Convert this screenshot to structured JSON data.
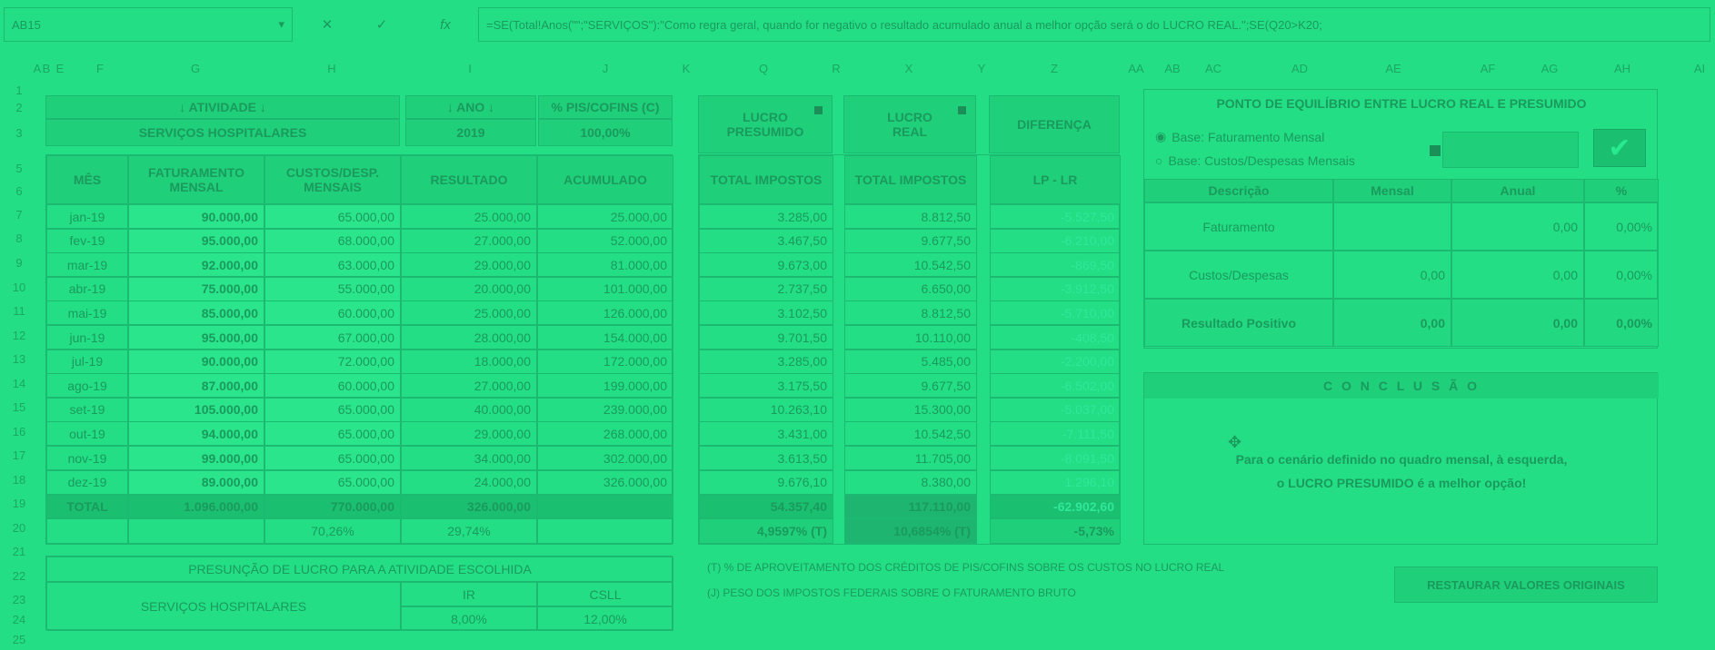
{
  "formula_bar": {
    "name_box": "AB15",
    "formula": "=SE(Total!Anos(\"\";\"SERVIÇOS\"):\"Como regra geral, quando for negativo o resultado acumulado anual a melhor opção será o do LUCRO REAL.\";SE(Q20>K20;",
    "cancel_symbol": "✕",
    "enter_symbol": "✓",
    "fx_symbol": "fx"
  },
  "columns": [
    "A",
    "B",
    "E",
    "F",
    "G",
    "H",
    "I",
    "J",
    "K",
    "Q",
    "R",
    "X",
    "Y",
    "Z",
    "AA",
    "AB",
    "AC",
    "AD",
    "AE",
    "AF",
    "AG",
    "AH",
    "AI"
  ],
  "rows": [
    "1",
    "2",
    "3",
    "5",
    "6",
    "7",
    "8",
    "9",
    "10",
    "11",
    "12",
    "13",
    "14",
    "15",
    "16",
    "17",
    "18",
    "19",
    "20",
    "21",
    "22",
    "23",
    "24",
    "25"
  ],
  "main_table": {
    "atividade_label": "↓ ATIVIDADE ↓",
    "atividade_value": "SERVIÇOS HOSPITALARES",
    "ano_label": "↓ ANO ↓",
    "ano_value": "2019",
    "pis_label": "% PIS/COFINS (C)",
    "pis_value": "100,00%",
    "headers": [
      "MÊS",
      "FATURAMENTO MENSAL",
      "CUSTOS/DESP. MENSAIS",
      "RESULTADO",
      "ACUMULADO"
    ],
    "rows": [
      [
        "jan-19",
        "90.000,00",
        "65.000,00",
        "25.000,00",
        "25.000,00"
      ],
      [
        "fev-19",
        "95.000,00",
        "68.000,00",
        "27.000,00",
        "52.000,00"
      ],
      [
        "mar-19",
        "92.000,00",
        "63.000,00",
        "29.000,00",
        "81.000,00"
      ],
      [
        "abr-19",
        "75.000,00",
        "55.000,00",
        "20.000,00",
        "101.000,00"
      ],
      [
        "mai-19",
        "85.000,00",
        "60.000,00",
        "25.000,00",
        "126.000,00"
      ],
      [
        "jun-19",
        "95.000,00",
        "67.000,00",
        "28.000,00",
        "154.000,00"
      ],
      [
        "jul-19",
        "90.000,00",
        "72.000,00",
        "18.000,00",
        "172.000,00"
      ],
      [
        "ago-19",
        "87.000,00",
        "60.000,00",
        "27.000,00",
        "199.000,00"
      ],
      [
        "set-19",
        "105.000,00",
        "65.000,00",
        "40.000,00",
        "239.000,00"
      ],
      [
        "out-19",
        "94.000,00",
        "65.000,00",
        "29.000,00",
        "268.000,00"
      ],
      [
        "nov-19",
        "99.000,00",
        "65.000,00",
        "34.000,00",
        "302.000,00"
      ],
      [
        "dez-19",
        "89.000,00",
        "65.000,00",
        "24.000,00",
        "326.000,00"
      ]
    ],
    "total_label": "TOTAL",
    "total_fat": "1.096.000,00",
    "total_custos": "770.000,00",
    "total_res": "326.000,00",
    "pct_custos": "70,26%",
    "pct_res": "29,74%"
  },
  "presuncao": {
    "title": "PRESUNÇÃO DE LUCRO PARA A ATIVIDADE ESCOLHIDA",
    "activity": "SERVIÇOS HOSPITALARES",
    "ir_label": "IR",
    "csll_label": "CSLL",
    "ir_value": "8,00%",
    "csll_value": "12,00%"
  },
  "impostos": {
    "lp_header": "LUCRO PRESUMIDO",
    "lr_header": "LUCRO REAL",
    "dif_header": "DIFERENÇA",
    "total_impostos": "TOTAL IMPOSTOS",
    "dif_sub": "LP - LR",
    "rows": [
      [
        "3.285,00",
        "8.812,50",
        "-5.527,50"
      ],
      [
        "3.467,50",
        "9.677,50",
        "-6.210,00"
      ],
      [
        "9.673,00",
        "10.542,50",
        "-869,50"
      ],
      [
        "2.737,50",
        "6.650,00",
        "-3.912,50"
      ],
      [
        "3.102,50",
        "8.812,50",
        "-5.710,00"
      ],
      [
        "9.701,50",
        "10.110,00",
        "-408,50"
      ],
      [
        "3.285,00",
        "5.485,00",
        "-2.200,00"
      ],
      [
        "3.175,50",
        "9.677,50",
        "-6.502,00"
      ],
      [
        "10.263,10",
        "15.300,00",
        "-5.037,00"
      ],
      [
        "3.431,00",
        "10.542,50",
        "-7.111,50"
      ],
      [
        "3.613,50",
        "11.705,00",
        "-8.091,50"
      ],
      [
        "9.676,10",
        "8.380,00",
        "1.296,10"
      ]
    ],
    "total_lp": "54.357,40",
    "total_lr": "117.110,00",
    "total_dif": "-62.902,60",
    "pct_lp": "4,9597% (T)",
    "pct_lr": "10,6854% (T)",
    "pct_dif": "-5,73%"
  },
  "notes": {
    "note1": "(T) % DE APROVEITAMENTO DOS CRÉDITOS DE PIS/COFINS SOBRE OS CUSTOS NO LUCRO REAL",
    "note2": "(J) PESO DOS IMPOSTOS FEDERAIS SOBRE O FATURAMENTO BRUTO"
  },
  "equilibrio": {
    "title": "PONTO DE EQUILÍBRIO ENTRE LUCRO REAL E PRESUMIDO",
    "radio1": "Base: Faturamento Mensal",
    "radio2": "Base: Custos/Despesas Mensais",
    "dropdown_value": "",
    "confirm_icon": "checkmark-icon",
    "headers": [
      "Descrição",
      "Mensal",
      "Anual",
      "%"
    ],
    "rows": [
      [
        "Faturamento",
        "",
        "0,00",
        "0,00%"
      ],
      [
        "Custos/Despesas",
        "0,00",
        "0,00",
        "0,00%"
      ],
      [
        "Resultado Positivo",
        "0,00",
        "0,00",
        "0,00%"
      ]
    ]
  },
  "conclusao": {
    "title": "C O N C L U S Ã O",
    "line1": "Para o cenário definido no quadro mensal, à esquerda,",
    "line2": "o LUCRO PRESUMIDO é a melhor opção!"
  },
  "restore_button": "RESTAURAR VALORES ORIGINAIS",
  "colors": {
    "background": "#23de85",
    "text": "#1a9a5c"
  }
}
